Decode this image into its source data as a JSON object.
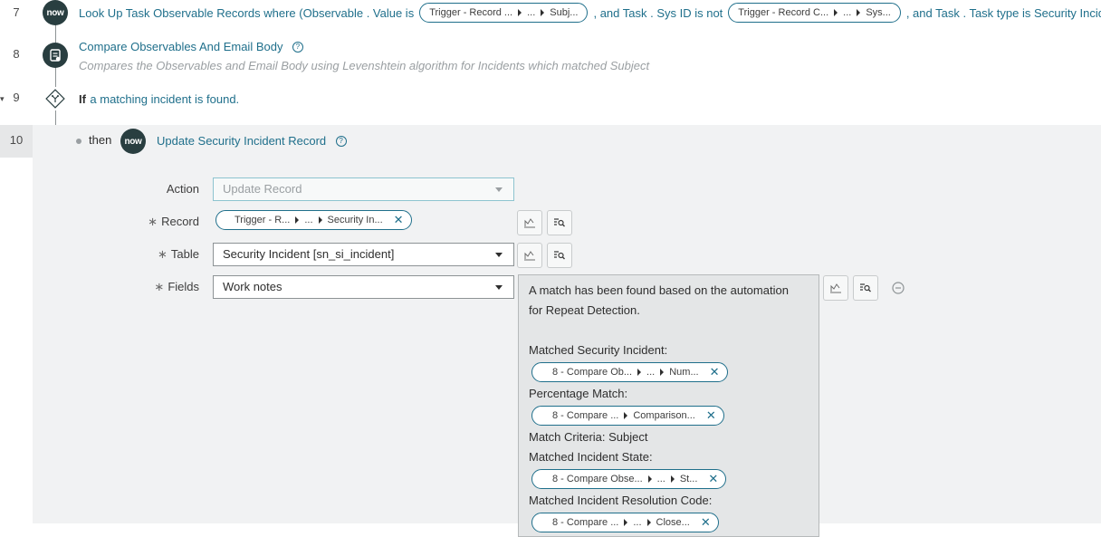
{
  "steps": [
    {
      "number": "7",
      "icon": "now-icon",
      "icon_text": "now",
      "title_parts": {
        "prefix": "Look Up Task Observable Records where (Observable . Value is",
        "pill1": [
          "Trigger - Record ...",
          "...",
          "Subj..."
        ],
        "middle": ", and Task . Sys ID is not",
        "pill2": [
          "Trigger - Record C...",
          "...",
          "Sys..."
        ],
        "suffix": ", and Task . Task type is Security Incid..."
      }
    },
    {
      "number": "8",
      "icon": "script-icon",
      "title": "Compare Observables And Email Body",
      "description": "Compares the Observables and Email Body using Levenshtein algorithm for Incidents which matched Subject"
    },
    {
      "number": "9",
      "icon": "branch-icon",
      "keyword": "If",
      "condition": "a matching incident is found."
    },
    {
      "number": "10",
      "connector": "then",
      "icon": "now-icon",
      "icon_text": "now",
      "title": "Update Security Incident Record"
    }
  ],
  "form": {
    "action_label": "Action",
    "action_value": "Update Record",
    "record_label": "Record",
    "record_pill": [
      "Trigger - R...",
      "...",
      "Security In..."
    ],
    "table_label": "Table",
    "table_value": "Security Incident [sn_si_incident]",
    "fields_label": "Fields",
    "fields_value": "Work notes",
    "required_mark": "∗",
    "worknotes": {
      "line1": "A match has been found based on the automation",
      "line2": "for Repeat Detection.",
      "matched_incident_label": "Matched Security Incident:",
      "matched_incident_pill": [
        "8 - Compare Ob...",
        "...",
        "Num..."
      ],
      "percentage_label": "Percentage Match:",
      "percentage_pill": [
        "8 - Compare ...",
        "Comparison..."
      ],
      "criteria": "Match Criteria: Subject",
      "state_label": "Matched Incident State:",
      "state_pill": [
        "8 - Compare Obse...",
        "...",
        "St..."
      ],
      "resolution_label": "Matched Incident Resolution Code:",
      "resolution_pill": [
        "8 - Compare ...",
        "...",
        "Close..."
      ]
    }
  },
  "colors": {
    "link": "#1f6f8b",
    "icon_bg": "#293e40",
    "section_bg": "#f1f2f3"
  }
}
